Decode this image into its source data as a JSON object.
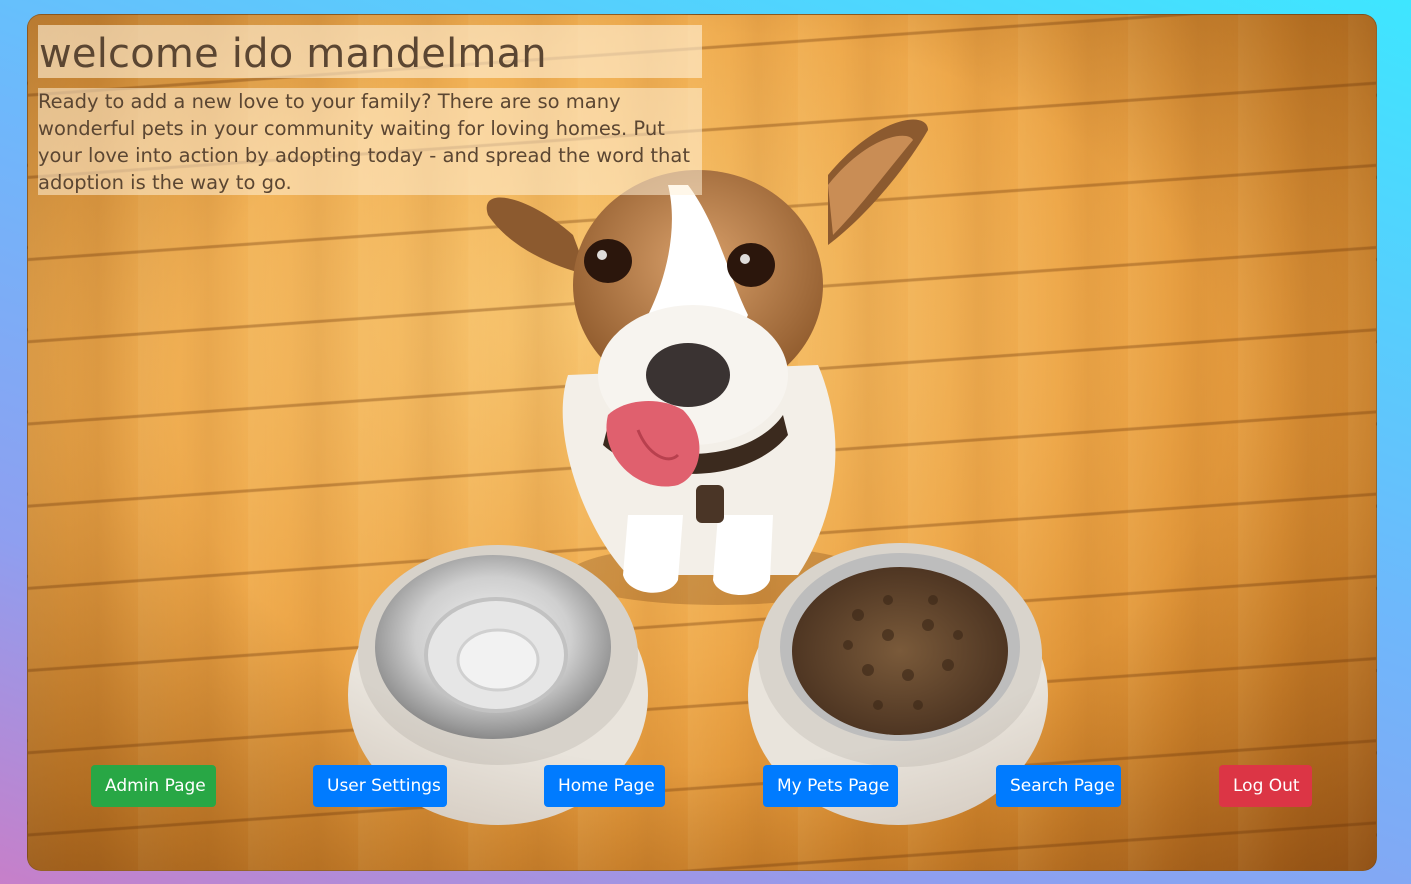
{
  "header": {
    "title": "welcome ido mandelman",
    "intro": "Ready to add a new love to your family? There are so many wonderful pets in your community waiting for loving homes. Put your love into action by adopting today - and spread the word that adoption is the way to go."
  },
  "nav": {
    "admin_label": "Admin Page",
    "settings_label": "User Settings",
    "home_label": "Home Page",
    "mypets_label": "My Pets Page",
    "search_label": "Search Page",
    "logout_label": "Log Out"
  },
  "colors": {
    "admin_button": "#28a745",
    "nav_button": "#007bff",
    "logout_button": "#dc3545"
  },
  "background_image": {
    "subject": "dog-with-food-bowls"
  }
}
